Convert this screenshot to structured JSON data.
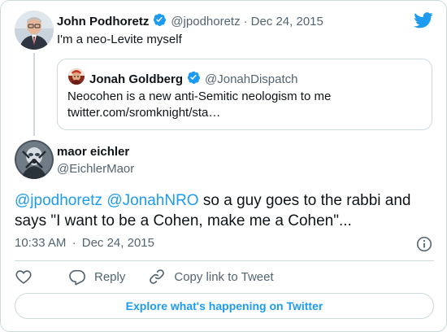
{
  "parent_tweet": {
    "author_name": "John Podhoretz",
    "author_handle": "@jpodhoretz",
    "separator": "·",
    "date": "Dec 24, 2015",
    "text": "I'm a neo-Levite myself",
    "verified": true
  },
  "quoted_tweet": {
    "author_name": "Jonah Goldberg",
    "author_handle": "@JonahDispatch",
    "verified": true,
    "text_line1": "Neocohen is a new anti-Semitic neologism to me",
    "text_line2": "twitter.com/sromknight/sta…"
  },
  "main_tweet": {
    "author_name": "maor eichler",
    "author_handle": "@EichlerMaor",
    "mention1": "@jpodhoretz",
    "mention2": "@JonahNRO",
    "text_line1_rest": "so a guy goes to the rabbi and",
    "text_line2": "says \"I want to be a Cohen, make me a Cohen\"...",
    "time": "10:33 AM",
    "separator": "·",
    "date": "Dec 24, 2015"
  },
  "actions": {
    "reply_label": "Reply",
    "copy_link_label": "Copy link to Tweet"
  },
  "explore_label": "Explore what's happening on Twitter",
  "icons": {
    "brand": "twitter-bird-icon",
    "verified": "verified-badge-icon",
    "info": "info-icon",
    "like": "heart-icon",
    "reply": "reply-bubble-icon",
    "copy": "link-icon"
  },
  "colors": {
    "accent": "#1d9bf0",
    "text": "#0f1419",
    "secondary": "#536471",
    "border": "#cfd9de"
  }
}
